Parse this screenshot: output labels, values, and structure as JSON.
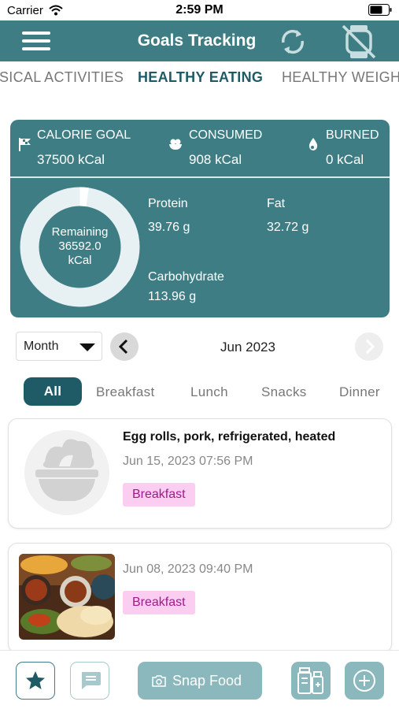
{
  "status_bar": {
    "carrier": "Carrier",
    "time": "2:59 PM"
  },
  "header": {
    "title": "Goals Tracking",
    "icons": [
      "menu-icon",
      "sync-icon",
      "watch-off-icon"
    ]
  },
  "category_tabs": [
    {
      "label": "SICAL ACTIVITIES",
      "active": false
    },
    {
      "label": "HEALTHY EATING",
      "active": true
    },
    {
      "label": "HEALTHY WEIGHT",
      "active": false
    }
  ],
  "summary": {
    "calorie_goal": {
      "label": "CALORIE GOAL",
      "value": "37500 kCal",
      "icon": "flag-icon"
    },
    "consumed": {
      "label": "CONSUMED",
      "value": "908 kCal",
      "icon": "food-bowl-icon"
    },
    "burned": {
      "label": "BURNED",
      "value": "0 kCal",
      "icon": "flame-drop-icon"
    },
    "remaining": {
      "label": "Remaining",
      "value": "36592.0",
      "unit": "kCal",
      "consumed_fraction": 0.024
    },
    "protein": {
      "label": "Protein",
      "value": "39.76 g"
    },
    "fat": {
      "label": "Fat",
      "value": "32.72 g"
    },
    "carbohydrate": {
      "label": "Carbohydrate",
      "value": "113.96 g"
    },
    "colors": {
      "card": "#3f7d84",
      "ring": "#e7f1f3"
    }
  },
  "period": {
    "selected": "Month",
    "month_label": "Jun 2023"
  },
  "meal_tabs": [
    {
      "label": "All",
      "active": true
    },
    {
      "label": "Breakfast",
      "active": false
    },
    {
      "label": "Lunch",
      "active": false
    },
    {
      "label": "Snacks",
      "active": false
    },
    {
      "label": "Dinner",
      "active": false
    }
  ],
  "entries": [
    {
      "title": "Egg rolls, pork, refrigerated, heated",
      "date": "Jun 15, 2023 07:56 PM",
      "tag": "Breakfast",
      "image": "placeholder-bowl-icon"
    },
    {
      "title": "",
      "date": "Jun 08, 2023 09:40 PM",
      "tag": "Breakfast",
      "image": "food-photo"
    }
  ],
  "bottom_bar": {
    "snap_label": "Snap Food",
    "icons": [
      "star-icon",
      "chat-icon",
      "camera-icon",
      "medication-icon",
      "add-icon"
    ]
  }
}
